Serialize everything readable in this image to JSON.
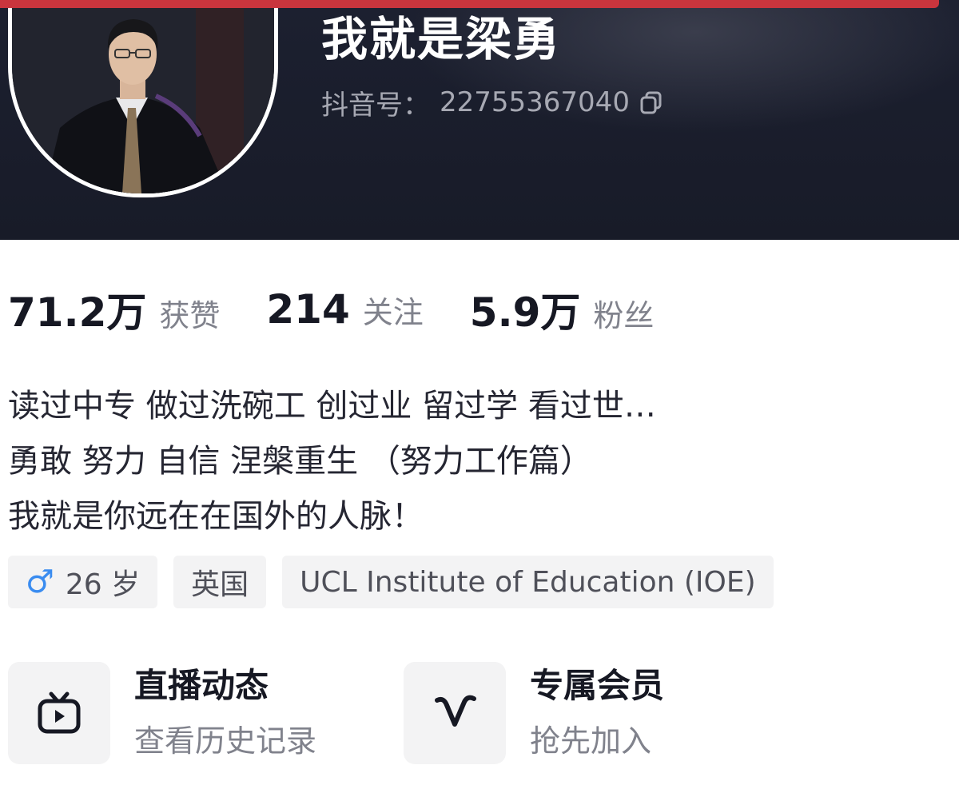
{
  "profile": {
    "nickname": "我就是梁勇",
    "douyin_id_label": "抖音号：",
    "douyin_id": "22755367040"
  },
  "stats": [
    {
      "value": "71.2万",
      "label": "获赞"
    },
    {
      "value": "214",
      "label": "关注"
    },
    {
      "value": "5.9万",
      "label": "粉丝"
    }
  ],
  "bio": {
    "line1": "读过中专 做过洗碗工 创过业 留过学 看过世…",
    "line2": "勇敢 努力 自信  涅槃重生  （努力工作篇）",
    "line3": "我就是你远在在国外的人脉！"
  },
  "tags": {
    "gender_symbol": "♂",
    "age": "26 岁",
    "location": "英国",
    "school": "UCL Institute of Education (IOE)"
  },
  "services": [
    {
      "title": "直播动态",
      "subtitle": "查看历史记录",
      "icon": "tv-icon"
    },
    {
      "title": "专属会员",
      "subtitle": "抢先加入",
      "icon": "vip-v-icon"
    }
  ],
  "colors": {
    "header_bg": "#1a1d2b",
    "top_strip": "#c9353d",
    "gender": "#3a8cf0",
    "muted_text": "#80828c"
  }
}
